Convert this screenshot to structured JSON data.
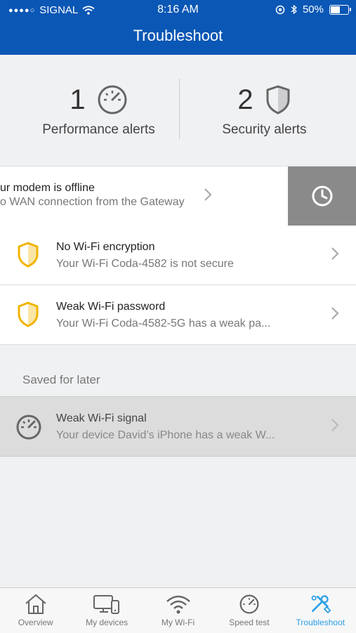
{
  "status_bar": {
    "carrier": "SIGNAL",
    "time": "8:16 AM",
    "battery_percent": "50%",
    "battery_level": 0.5
  },
  "header": {
    "title": "Troubleshoot"
  },
  "summary": {
    "performance": {
      "count": "1",
      "label": "Performance alerts",
      "icon": "gauge-icon"
    },
    "security": {
      "count": "2",
      "label": "Security alerts",
      "icon": "shield-icon"
    }
  },
  "alerts": [
    {
      "title": "ur modem is offline",
      "subtitle": "o WAN connection from the Gateway",
      "action_icon": "clock-icon"
    },
    {
      "title": "No Wi-Fi encryption",
      "subtitle": "Your Wi-Fi Coda-4582 is not secure",
      "icon": "shield-icon"
    },
    {
      "title": "Weak Wi-Fi password",
      "subtitle": "Your Wi-Fi Coda-4582-5G has a weak pa...",
      "icon": "shield-icon"
    }
  ],
  "saved_section": {
    "label": "Saved for later",
    "items": [
      {
        "title": "Weak Wi-Fi signal",
        "subtitle": "Your device David’s iPhone has a weak W...",
        "icon": "gauge-icon"
      }
    ]
  },
  "tabs": [
    {
      "label": "Overview",
      "icon": "home-icon",
      "active": false
    },
    {
      "label": "My devices",
      "icon": "devices-icon",
      "active": false
    },
    {
      "label": "My Wi-Fi",
      "icon": "wifi-icon",
      "active": false
    },
    {
      "label": "Speed test",
      "icon": "gauge-icon",
      "active": false
    },
    {
      "label": "Troubleshoot",
      "icon": "tools-icon",
      "active": true
    }
  ],
  "colors": {
    "header_bg": "#0a57b5",
    "warning_yellow": "#f0b400",
    "active_tab": "#2a9fe8",
    "snooze_bg": "#8a8a8a"
  }
}
